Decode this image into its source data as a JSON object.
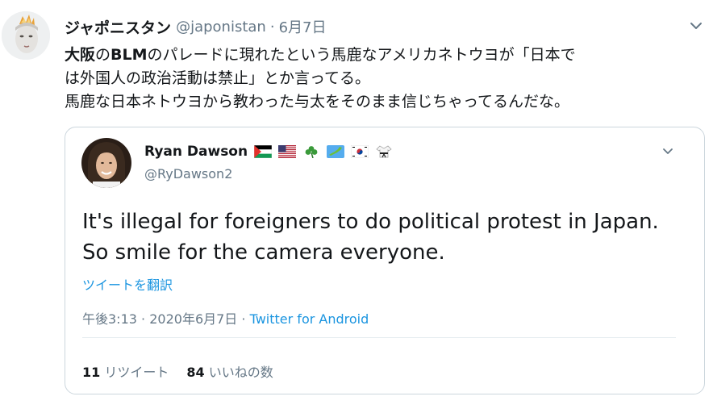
{
  "tweet": {
    "author_name": "ジャポニスタン",
    "author_handle": "@japonistan",
    "separator": "·",
    "date": "6月7日",
    "line1_bold1": "大阪",
    "line1_part2": "の",
    "line1_bold2": "BLM",
    "line1_part3": "のパレードに現れたという馬鹿なアメリカネトウヨが「日本で",
    "line2": "は外国人の政治活動は禁止」とか言ってる。",
    "line3": "馬鹿な日本ネトウヨから教わった与太をそのまま信じちゃってるんだな。"
  },
  "quote": {
    "author_name": "Ryan Dawson",
    "author_handle": "@RyDawson2",
    "text_line1": "It's illegal for foreigners to do political protest in Japan.",
    "text_line2": "So smile for the camera everyone.",
    "translate_label": "ツイートを翻訳",
    "time": "午後3:13",
    "meta_sep": "·",
    "date": "2020年6月7日",
    "source": "Twitter for Android",
    "retweet_count": "11",
    "retweet_label": "リツイート",
    "like_count": "84",
    "like_label": "いいねの数",
    "flags": [
      "palestine-flag",
      "usa-flag",
      "shamrock",
      "japan-map",
      "south-korea-flag",
      "martial-arts-uniform"
    ]
  },
  "colors": {
    "link": "#1b95e0",
    "secondary_text": "#657786",
    "primary_text": "#14171a",
    "border": "#ccd6dd"
  }
}
